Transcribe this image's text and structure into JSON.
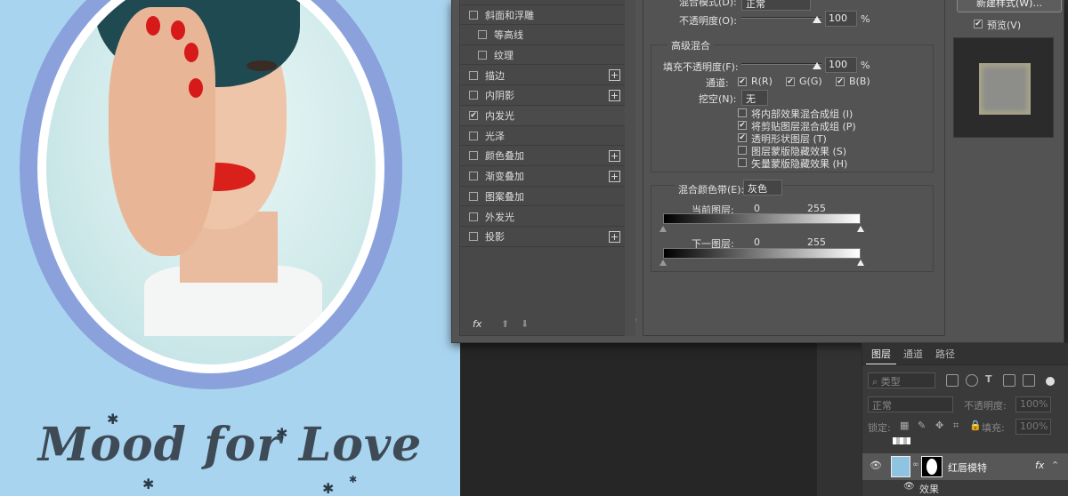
{
  "artwork": {
    "title_text": "Mood for Love"
  },
  "style_list": {
    "items": [
      {
        "label": "斜面和浮雕",
        "checked": false,
        "indent": false,
        "plus": false
      },
      {
        "label": "等高线",
        "checked": false,
        "indent": true,
        "plus": false
      },
      {
        "label": "纹理",
        "checked": false,
        "indent": true,
        "plus": false
      },
      {
        "label": "描边",
        "checked": false,
        "indent": false,
        "plus": true
      },
      {
        "label": "内阴影",
        "checked": false,
        "indent": false,
        "plus": true
      },
      {
        "label": "内发光",
        "checked": true,
        "indent": false,
        "plus": false
      },
      {
        "label": "光泽",
        "checked": false,
        "indent": false,
        "plus": false
      },
      {
        "label": "颜色叠加",
        "checked": false,
        "indent": false,
        "plus": true
      },
      {
        "label": "渐变叠加",
        "checked": false,
        "indent": false,
        "plus": true
      },
      {
        "label": "图案叠加",
        "checked": false,
        "indent": false,
        "plus": false
      },
      {
        "label": "外发光",
        "checked": false,
        "indent": false,
        "plus": false
      },
      {
        "label": "投影",
        "checked": false,
        "indent": false,
        "plus": true
      }
    ],
    "footer_fx": "fx"
  },
  "blend_options": {
    "blend_mode_label": "混合模式(D):",
    "blend_mode_value": "正常",
    "opacity_label": "不透明度(O):",
    "opacity_value": "100",
    "percent": "%",
    "advanced_title": "高级混合",
    "fill_opacity_label": "填充不透明度(F):",
    "fill_opacity_value": "100",
    "channels_label": "通道:",
    "channel_r": "R(R)",
    "channel_g": "G(G)",
    "channel_b": "B(B)",
    "knockout_label": "挖空(N):",
    "knockout_value": "无",
    "options": [
      {
        "label": "将内部效果混合成组 (I)",
        "checked": false
      },
      {
        "label": "将剪贴图层混合成组 (P)",
        "checked": true
      },
      {
        "label": "透明形状图层 (T)",
        "checked": true
      },
      {
        "label": "图层蒙版隐藏效果 (S)",
        "checked": false
      },
      {
        "label": "矢量蒙版隐藏效果 (H)",
        "checked": false
      }
    ],
    "blend_if_label": "混合颜色带(E):",
    "blend_if_value": "灰色",
    "this_layer_label": "当前图层:",
    "underlying_label": "下一图层:",
    "range_min": "0",
    "range_max": "255"
  },
  "right_column": {
    "new_style_label": "新建样式(W)...",
    "preview_label": "预览(V)",
    "preview_checked": true
  },
  "layers_panel": {
    "tabs": [
      "图层",
      "通道",
      "路径"
    ],
    "filter_kind": "类型",
    "blend_mode": "正常",
    "opacity_label": "不透明度:",
    "opacity_value": "100%",
    "lock_label": "锁定:",
    "fill_label": "填充:",
    "fill_value": "100%",
    "layer_name": "红唇模特",
    "layer_fx": "fx",
    "effects_label": "效果"
  }
}
